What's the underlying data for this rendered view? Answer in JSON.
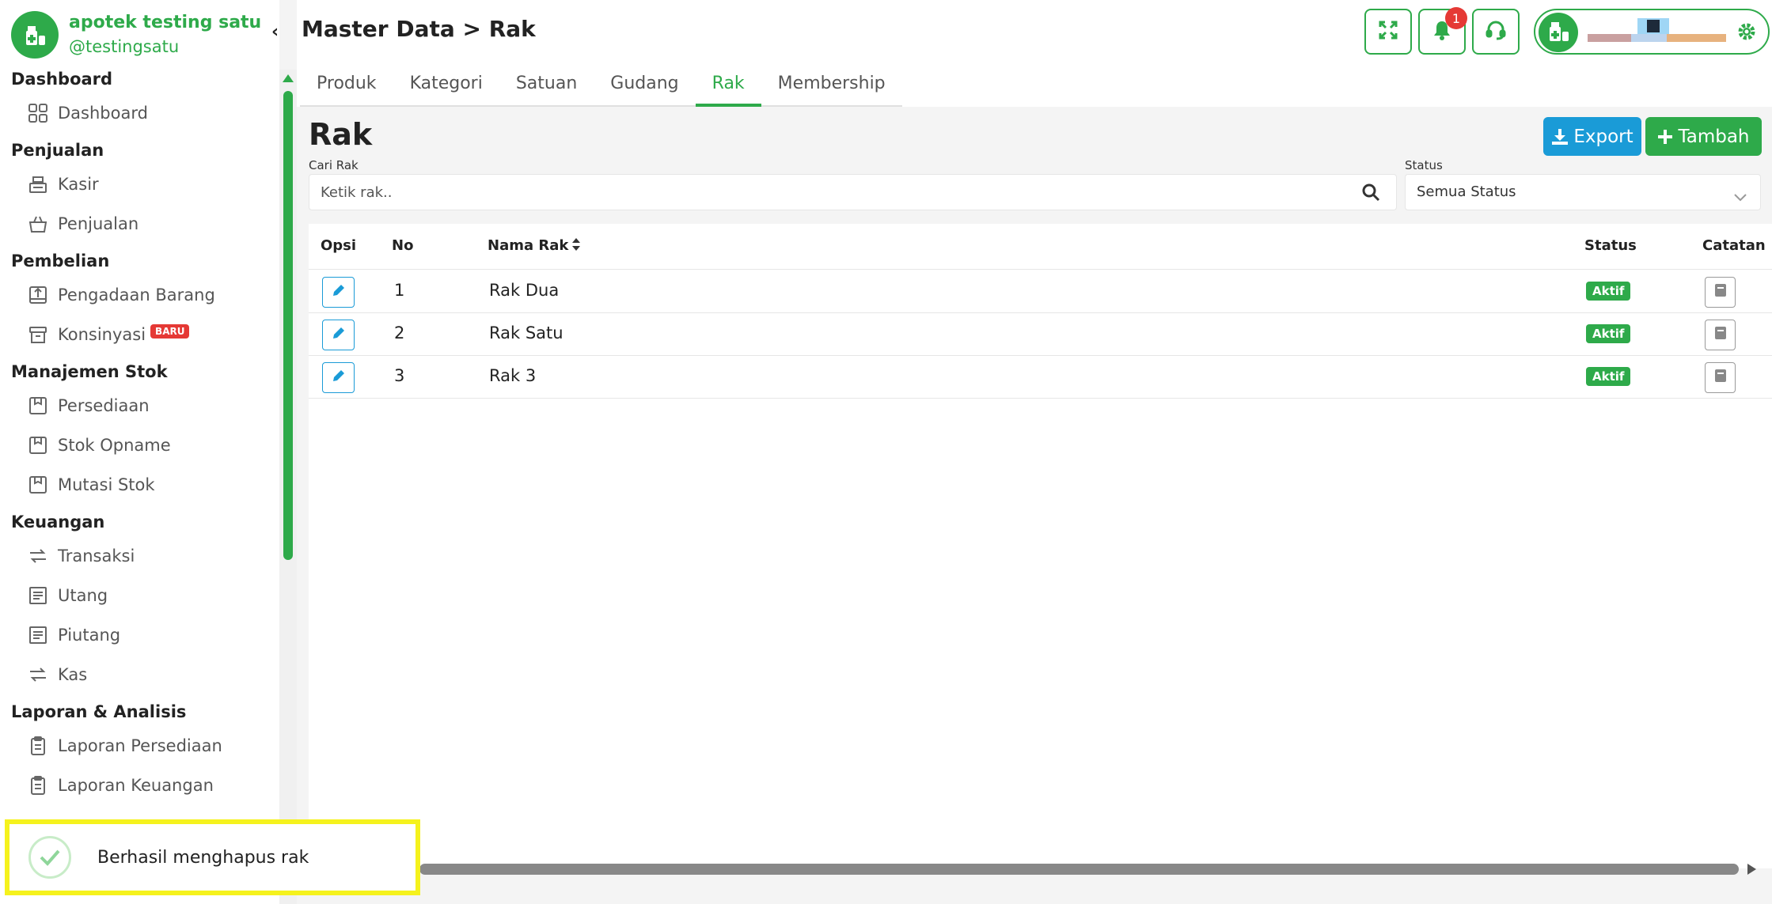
{
  "brand": {
    "name": "apotek testing satu",
    "handle": "@testingsatu"
  },
  "header": {
    "title": "Master Data > Rak",
    "notification_count": "1"
  },
  "sidebar": {
    "sections": [
      {
        "title": "Dashboard",
        "items": [
          {
            "label": "Dashboard",
            "icon": "grid-icon"
          }
        ]
      },
      {
        "title": "Penjualan",
        "items": [
          {
            "label": "Kasir",
            "icon": "cash-register-icon"
          },
          {
            "label": "Penjualan",
            "icon": "basket-icon"
          }
        ]
      },
      {
        "title": "Pembelian",
        "items": [
          {
            "label": "Pengadaan Barang",
            "icon": "inbox-icon"
          },
          {
            "label": "Konsinyasi",
            "icon": "archive-icon",
            "badge": "BARU"
          }
        ]
      },
      {
        "title": "Manajemen Stok",
        "items": [
          {
            "label": "Persediaan",
            "icon": "box-icon"
          },
          {
            "label": "Stok Opname",
            "icon": "box-icon"
          },
          {
            "label": "Mutasi Stok",
            "icon": "box-icon"
          }
        ]
      },
      {
        "title": "Keuangan",
        "items": [
          {
            "label": "Transaksi",
            "icon": "exchange-icon"
          },
          {
            "label": "Utang",
            "icon": "receipt-icon"
          },
          {
            "label": "Piutang",
            "icon": "receipt-icon"
          },
          {
            "label": "Kas",
            "icon": "exchange-icon"
          }
        ]
      },
      {
        "title": "Laporan & Analisis",
        "items": [
          {
            "label": "Laporan Persediaan",
            "icon": "clipboard-icon"
          },
          {
            "label": "Laporan Keuangan",
            "icon": "clipboard-icon"
          }
        ]
      }
    ]
  },
  "tabs": [
    {
      "label": "Produk",
      "active": false
    },
    {
      "label": "Kategori",
      "active": false
    },
    {
      "label": "Satuan",
      "active": false
    },
    {
      "label": "Gudang",
      "active": false
    },
    {
      "label": "Rak",
      "active": true
    },
    {
      "label": "Membership",
      "active": false
    }
  ],
  "main": {
    "title": "Rak",
    "export_label": "Export",
    "add_label": "Tambah",
    "search_label": "Cari Rak",
    "search_placeholder": "Ketik rak..",
    "status_label": "Status",
    "status_value": "Semua Status"
  },
  "table": {
    "headers": {
      "opsi": "Opsi",
      "no": "No",
      "nama": "Nama Rak",
      "status": "Status",
      "catatan": "Catatan"
    },
    "rows": [
      {
        "no": "1",
        "nama": "Rak Dua",
        "status": "Aktif"
      },
      {
        "no": "2",
        "nama": "Rak Satu",
        "status": "Aktif"
      },
      {
        "no": "3",
        "nama": "Rak 3",
        "status": "Aktif"
      }
    ]
  },
  "toast": {
    "message": "Berhasil menghapus rak"
  },
  "colors": {
    "brand": "#2eaa4a",
    "export": "#1a9bd7",
    "danger": "#e53935"
  }
}
